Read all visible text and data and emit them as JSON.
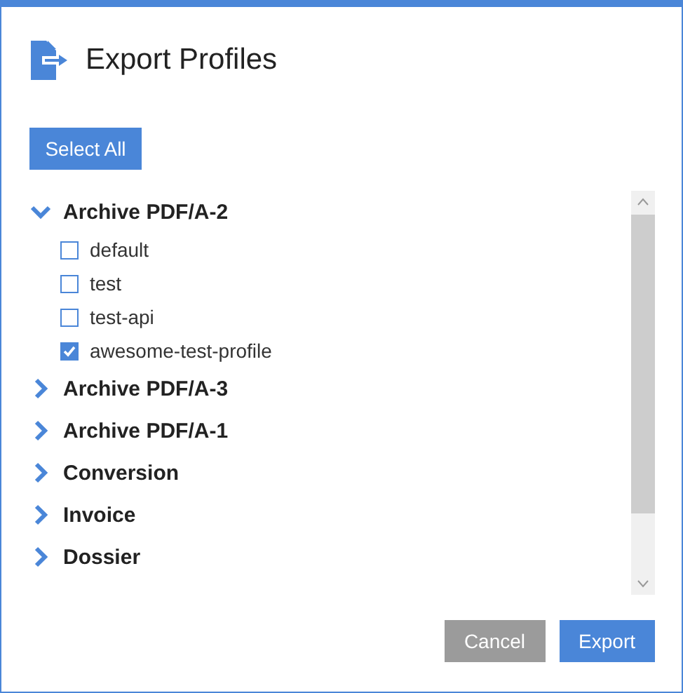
{
  "dialog": {
    "title": "Export Profiles"
  },
  "select_all": "Select All",
  "groups": [
    {
      "label": "Archive PDF/A-2",
      "expanded": true,
      "children": [
        {
          "label": "default",
          "checked": false
        },
        {
          "label": "test",
          "checked": false
        },
        {
          "label": "test-api",
          "checked": false
        },
        {
          "label": "awesome-test-profile",
          "checked": true
        }
      ]
    },
    {
      "label": "Archive PDF/A-3",
      "expanded": false
    },
    {
      "label": "Archive PDF/A-1",
      "expanded": false
    },
    {
      "label": "Conversion",
      "expanded": false
    },
    {
      "label": "Invoice",
      "expanded": false
    },
    {
      "label": "Dossier",
      "expanded": false
    }
  ],
  "buttons": [
    {
      "label": "Cancel",
      "kind": "secondary"
    },
    {
      "label": "Export",
      "kind": "primary"
    }
  ]
}
